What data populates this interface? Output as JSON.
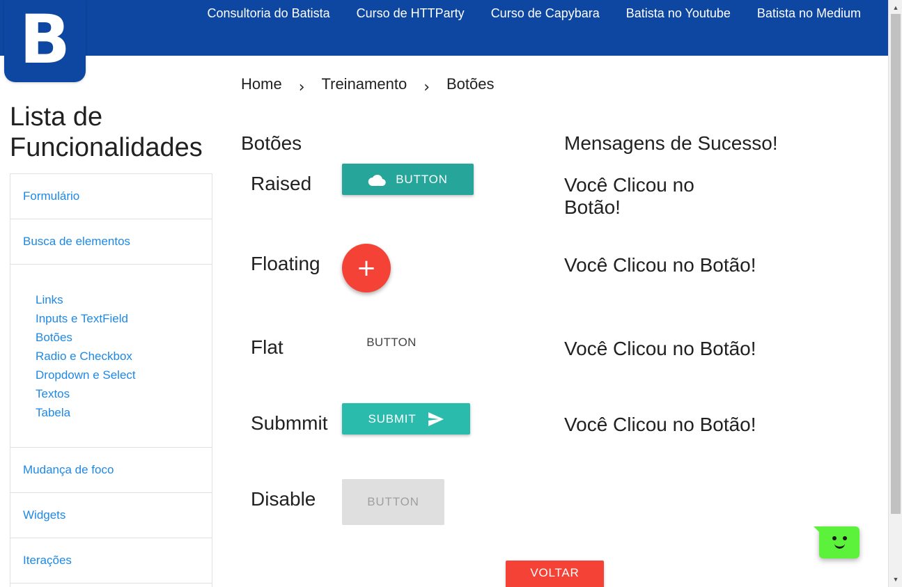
{
  "logo": {
    "letter": "B"
  },
  "nav": {
    "links": [
      "Consultoria do Batista",
      "Curso de HTTParty",
      "Curso de Capybara",
      "Batista no Youtube",
      "Batista no Medium"
    ]
  },
  "breadcrumb": {
    "items": [
      "Home",
      "Treinamento",
      "Botões"
    ],
    "separator": "›"
  },
  "sidebar": {
    "title_line1": "Lista de",
    "title_line2": "Funcionalidades",
    "items": [
      "Formulário",
      "Busca de elementos"
    ],
    "sub_items": [
      "Links",
      "Inputs e TextField",
      "Botões",
      "Radio e Checkbox",
      "Dropdown e Select",
      "Textos",
      "Tabela"
    ],
    "items_after": [
      "Mudança de foco",
      "Widgets",
      "Iterações"
    ]
  },
  "main": {
    "buttons_heading": "Botões",
    "messages_heading": "Mensagens de Sucesso!",
    "rows": {
      "raised": {
        "label": "Raised",
        "button": "BUTTON",
        "icon": "cloud-icon",
        "message_line1": "Você Clicou no",
        "message_line2": "Botão!"
      },
      "floating": {
        "label": "Floating",
        "button": "+",
        "message": "Você Clicou no Botão!"
      },
      "flat": {
        "label": "Flat",
        "button": "BUTTON",
        "message": "Você Clicou no Botão!"
      },
      "submit": {
        "label": "Submmit",
        "button": "SUBMIT",
        "icon": "send-icon",
        "message": "Você Clicou no Botão!"
      },
      "disable": {
        "label": "Disable",
        "button": "BUTTON"
      }
    },
    "back_button": "VOLTAR"
  },
  "colors": {
    "nav_bg": "#0d47a1",
    "link": "#1e88e5",
    "raised": "#26a69a",
    "floating": "#f44336",
    "submit": "#2bbbad",
    "disabled_bg": "#dfdfdf",
    "voltar": "#f44336",
    "chat_widget": "#5cf23c"
  },
  "chat_widget": {
    "icon": "smiley-chat-icon"
  },
  "scrollbar": {
    "icon_up": "triangle-up-icon",
    "icon_down": "triangle-down-icon"
  }
}
